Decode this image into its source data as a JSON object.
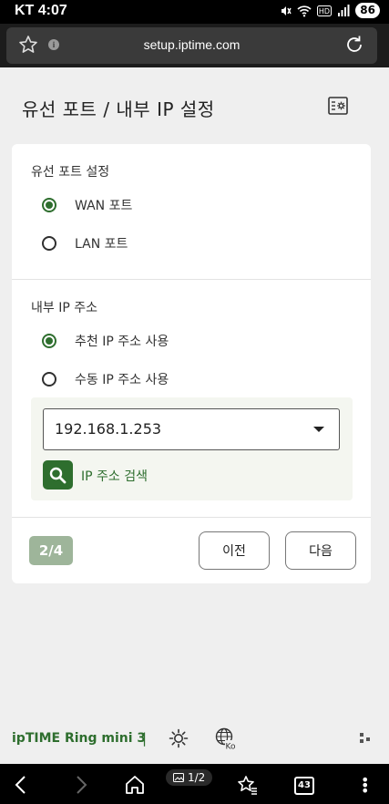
{
  "status_bar": {
    "carrier_time": "KT 4:07",
    "battery": "86"
  },
  "browser": {
    "url": "setup.iptime.com"
  },
  "page": {
    "title": "유선 포트 / 내부 IP 설정"
  },
  "wired_port": {
    "section_title": "유선 포트 설정",
    "options": [
      {
        "label": "WAN 포트",
        "selected": true
      },
      {
        "label": "LAN 포트",
        "selected": false
      }
    ]
  },
  "internal_ip": {
    "section_title": "내부 IP 주소",
    "options": [
      {
        "label": "추천 IP 주소 사용",
        "selected": true
      },
      {
        "label": "수동 IP 주소 사용",
        "selected": false
      }
    ],
    "selected_ip": "192.168.1.253",
    "search_label": "IP 주소 검색"
  },
  "wizard": {
    "step": "2/4",
    "prev_label": "이전",
    "next_label": "다음"
  },
  "footer": {
    "brand": "ipTIME Ring mini 3",
    "separator": "|"
  },
  "bottom_nav": {
    "page_indicator": "1/2",
    "tab_count": "43"
  },
  "colors": {
    "accent": "#2e6e2e",
    "step_badge": "#9eb59a",
    "background": "#efefef"
  }
}
